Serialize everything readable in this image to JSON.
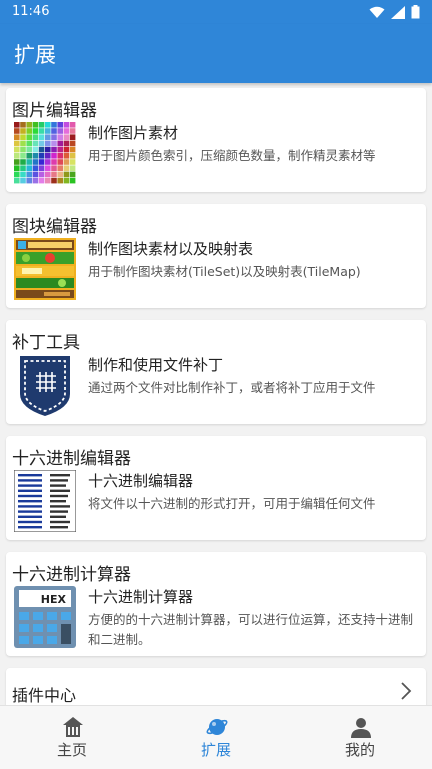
{
  "status_bar": {
    "time": "11:46"
  },
  "app_bar": {
    "title": "扩展"
  },
  "cards": [
    {
      "section_title": "图片编辑器",
      "item_title": "制作图片素材",
      "item_desc": "用于图片颜色索引，压缩颜色数量，制作精灵素材等",
      "icon": "pixel-palette-icon"
    },
    {
      "section_title": "图块编辑器",
      "item_title": "制作图块素材以及映射表",
      "item_desc": "用于制作图块素材(TileSet)以及映射表(TileMap)",
      "icon": "tileset-icon"
    },
    {
      "section_title": "补丁工具",
      "item_title": "制作和使用文件补丁",
      "item_desc": "通过两个文件对比制作补丁，或者将补丁应用于文件",
      "icon": "patch-icon"
    },
    {
      "section_title": "十六进制编辑器",
      "item_title": "十六进制编辑器",
      "item_desc": "将文件以十六进制的形式打开，可用于编辑任何文件",
      "icon": "hex-dump-icon"
    },
    {
      "section_title": "十六进制计算器",
      "item_title": "十六进制计算器",
      "item_desc": "方便的的十六进制计算器，可以进行位运算，还支持十进制和二进制。",
      "icon": "calculator-icon",
      "calc_display": "HEX"
    }
  ],
  "plugin_center": {
    "label": "插件中心"
  },
  "bottom_nav": [
    {
      "label": "主页",
      "icon": "home-icon",
      "active": false
    },
    {
      "label": "扩展",
      "icon": "planet-icon",
      "active": true
    },
    {
      "label": "我的",
      "icon": "person-icon",
      "active": false
    }
  ],
  "colors": {
    "primary": "#2f86d8",
    "background": "#f2f2f2"
  }
}
